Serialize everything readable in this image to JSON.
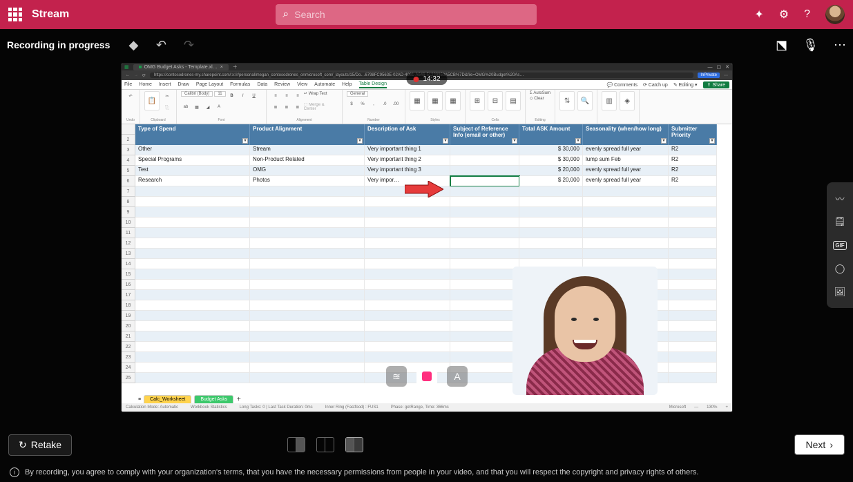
{
  "topbar": {
    "app_title": "Stream",
    "search_placeholder": "Search"
  },
  "rec": {
    "status": "Recording in progress",
    "timer": "14:32"
  },
  "browser": {
    "tab_title": "OMG Budget Asks - Template.xl…",
    "url": "https://contosodrones-my.sharepoint.com/:x:/r/personal/megan_contosodrones_onmicrosoft_com/_layouts/15/Do…6798FC9563E-02AD-4061-A646-51239950A5CB%7D&file=OMG%20Budget%20As…",
    "inprivate": "InPrivate"
  },
  "excel_menu": {
    "items": [
      "File",
      "Home",
      "Insert",
      "Draw",
      "Page Layout",
      "Formulas",
      "Data",
      "Review",
      "View",
      "Automate",
      "Help",
      "Table Design"
    ],
    "right": {
      "comments": "Comments",
      "catchup": "Catch up",
      "editing": "Editing",
      "share": "Share"
    }
  },
  "ribbon": {
    "font_name": "Calibri (Body)",
    "font_size": "11",
    "wrap": "Wrap Text",
    "merge": "Merge & Center",
    "num_fmt": "General",
    "cond": "Conditional Formatting",
    "fmt_table": "Format As Table",
    "styles": "Styles",
    "insert": "Insert",
    "delete": "Delete",
    "format": "Format",
    "autosum": "AutoSum",
    "clear": "Clear",
    "sort": "Sort & Filter",
    "find": "Find & Select",
    "clear_data": "Clear Data",
    "analyze": "Analyze Data",
    "grp_undo": "Undo",
    "grp_clip": "Clipboard",
    "grp_font": "Font",
    "grp_align": "Alignment",
    "grp_num": "Number",
    "grp_styles": "Styles",
    "grp_cells": "Cells",
    "grp_edit": "Editing"
  },
  "table": {
    "headers": [
      "Type of Spend",
      "Product Alignment",
      "Description of Ask",
      "Subject of Reference Info (email or other)",
      "Total ASK Amount",
      "Seasonality (when/how long)",
      "Submitter Priority"
    ],
    "rows": [
      {
        "r": 3,
        "c": [
          "Other",
          "Stream",
          "Very important thing 1",
          "",
          "$           30,000",
          "evenly spread full year",
          "R2"
        ]
      },
      {
        "r": 4,
        "c": [
          "Special Programs",
          "Non-Product Related",
          "Very important thing 2",
          "",
          "$           30,000",
          "lump sum Feb",
          "R2"
        ]
      },
      {
        "r": 5,
        "c": [
          "Test",
          "OMG",
          "Very important thing 3",
          "",
          "$           20,000",
          "evenly spread full year",
          "R2"
        ]
      },
      {
        "r": 6,
        "c": [
          "Research",
          "Photos",
          "Very impor…",
          "",
          "$           20,000",
          "evenly spread full year",
          "R2"
        ]
      }
    ],
    "row_numbers_extra": [
      2,
      7,
      8,
      9,
      10,
      11,
      12,
      13,
      14,
      15,
      16,
      17,
      18,
      19,
      20,
      21,
      22,
      23,
      24,
      25
    ]
  },
  "sheets": {
    "tab1": "Calc_Worksheet",
    "tab2": "Budget Asks"
  },
  "status": {
    "calc": "Calculation Mode: Automatic",
    "wb": "Workbook Statistics",
    "tasks": "Long Tasks: 0 | Last Task Duration: 0ms",
    "ring": "Inner Ring (Fastfood) : FUS1",
    "phase": "Phase: getRange, Time: 366ms",
    "brand": "Microsoft",
    "zoom": "130%"
  },
  "bottom": {
    "retake": "Retake",
    "next": "Next"
  },
  "disclaimer": "By recording, you agree to comply with your organization's terms, that you have the necessary permissions from people in your video, and that you will respect the copyright and privacy rights of others.",
  "icons": {
    "search": "⌕",
    "megaphone": "📣",
    "gear": "⚙",
    "help": "?",
    "eraser": "◧",
    "undo": "↶",
    "redo": "↷",
    "flip": "▢",
    "mic": "🎤",
    "more": "⋯",
    "refresh": "↻",
    "text": "A",
    "blur": "≋",
    "wave": "〰",
    "note": "🗒",
    "globe": "◯",
    "image": "🖼"
  }
}
